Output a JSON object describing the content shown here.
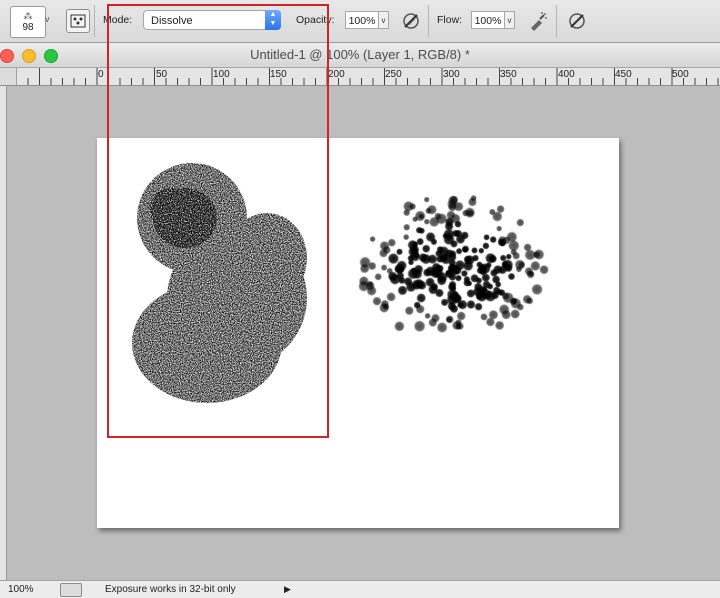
{
  "options_bar": {
    "brush_size": "98",
    "brush_glyph": "⁂",
    "mode_label": "Mode:",
    "mode_value": "Dissolve",
    "opacity_label": "Opacity:",
    "opacity_value": "100%",
    "flow_label": "Flow:",
    "flow_value": "100%"
  },
  "document": {
    "title": "Untitled-1 @ 100% (Layer 1, RGB/8) *"
  },
  "ruler": {
    "labels": [
      "0",
      "50",
      "100",
      "150",
      "200",
      "250",
      "300",
      "350",
      "400",
      "450",
      "500"
    ]
  },
  "status_bar": {
    "zoom": "100%",
    "message": "Exposure works in 32-bit only",
    "arrow": "▶"
  },
  "colors": {
    "highlight": "#d2232a",
    "workspace": "#bdbdbd"
  }
}
